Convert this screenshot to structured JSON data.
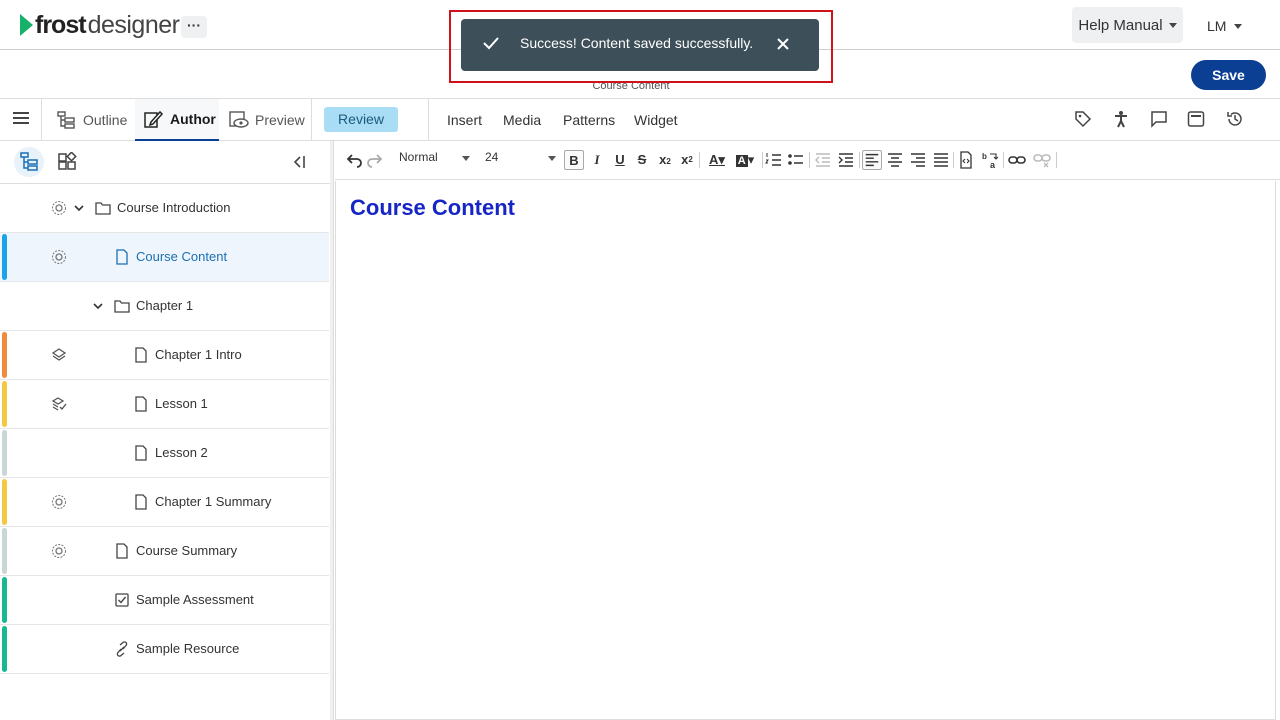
{
  "app": {
    "logo_frost": "frost",
    "logo_designer": "designer",
    "more_label": "···"
  },
  "header": {
    "help_label": "Help Manual",
    "user_label": "LM",
    "subtitle": "Course Content",
    "save_label": "Save"
  },
  "toast": {
    "message": "Success! Content saved successfully."
  },
  "modes": [
    {
      "label": "Outline",
      "icon": "outline-icon"
    },
    {
      "label": "Author",
      "icon": "author-icon",
      "active": true
    },
    {
      "label": "Preview",
      "icon": "preview-icon"
    }
  ],
  "review_label": "Review",
  "menus": [
    "Insert",
    "Media",
    "Patterns",
    "Widget"
  ],
  "right_tools": [
    "tag-icon",
    "accessibility-icon",
    "comment-icon",
    "panel-icon",
    "history-icon"
  ],
  "tree": [
    {
      "label": "Course Introduction",
      "type": "folder",
      "status": "settings",
      "bar": "",
      "expandable": true
    },
    {
      "label": "Course Content",
      "type": "page",
      "status": "settings",
      "bar": "#1aa3e8",
      "selected": true
    },
    {
      "label": "Chapter 1",
      "type": "folder",
      "status": "",
      "bar": "",
      "expandable": true
    },
    {
      "label": "Chapter 1 Intro",
      "type": "page",
      "status": "layers",
      "bar": "#f08a3c"
    },
    {
      "label": "Lesson 1",
      "type": "page",
      "status": "layers-check",
      "bar": "#f5c842"
    },
    {
      "label": "Lesson 2",
      "type": "page",
      "status": "",
      "bar": "#c8d6d6"
    },
    {
      "label": "Chapter 1 Summary",
      "type": "page",
      "status": "settings",
      "bar": "#f5c842"
    },
    {
      "label": "Course Summary",
      "type": "page",
      "status": "settings",
      "bar": "#c8d6d6"
    },
    {
      "label": "Sample Assessment",
      "type": "assessment",
      "status": "",
      "bar": "#17b890"
    },
    {
      "label": "Sample Resource",
      "type": "resource",
      "status": "",
      "bar": "#17b890"
    }
  ],
  "editor": {
    "style_select": "Normal",
    "size_select": "24",
    "heading": "Course Content"
  }
}
